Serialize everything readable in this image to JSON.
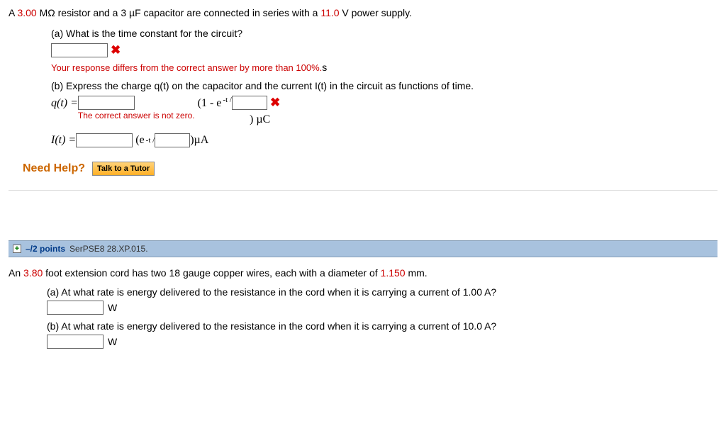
{
  "q1": {
    "intro": {
      "pre": "A ",
      "val1": "3.00",
      "mid1": " MΩ resistor and a 3 µF capacitor are connected in series with a ",
      "val2": "11.0",
      "post": " V power supply."
    },
    "a": {
      "label": "(a) What is the time constant for the circuit?",
      "error_pre": "Your response differs from the correct answer by more than 100%.",
      "error_unit": " s"
    },
    "b": {
      "label": "(b) Express the charge q(t) on the capacitor and the current I(t) in the circuit as functions of time.",
      "q_lhs": "q(t) = ",
      "q_mid": "(1 - e",
      "exp_pre": "-t / ",
      "q_close": ")",
      "q_unit": " µC",
      "q_note": "The correct answer is not zero.",
      "i_lhs": "I(t) = ",
      "i_mid": "(e",
      "i_close": ")",
      "i_unit": " µA"
    },
    "needhelp": {
      "label": "Need Help?",
      "btn": "Talk to a Tutor"
    }
  },
  "q2": {
    "header": {
      "expand": "+",
      "points": "–/2 points",
      "ref": "SerPSE8 28.XP.015."
    },
    "intro": {
      "pre": "An ",
      "val1": "3.80",
      "mid1": " foot extension cord has two 18 gauge copper wires, each with a diameter of ",
      "val2": "1.150",
      "post": " mm."
    },
    "a": {
      "label": "(a) At what rate is energy delivered to the resistance in the cord when it is carrying a current of 1.00 A?",
      "unit": "W"
    },
    "b": {
      "label": "(b) At what rate is energy delivered to the resistance in the cord when it is carrying a current of 10.0 A?",
      "unit": "W"
    }
  }
}
